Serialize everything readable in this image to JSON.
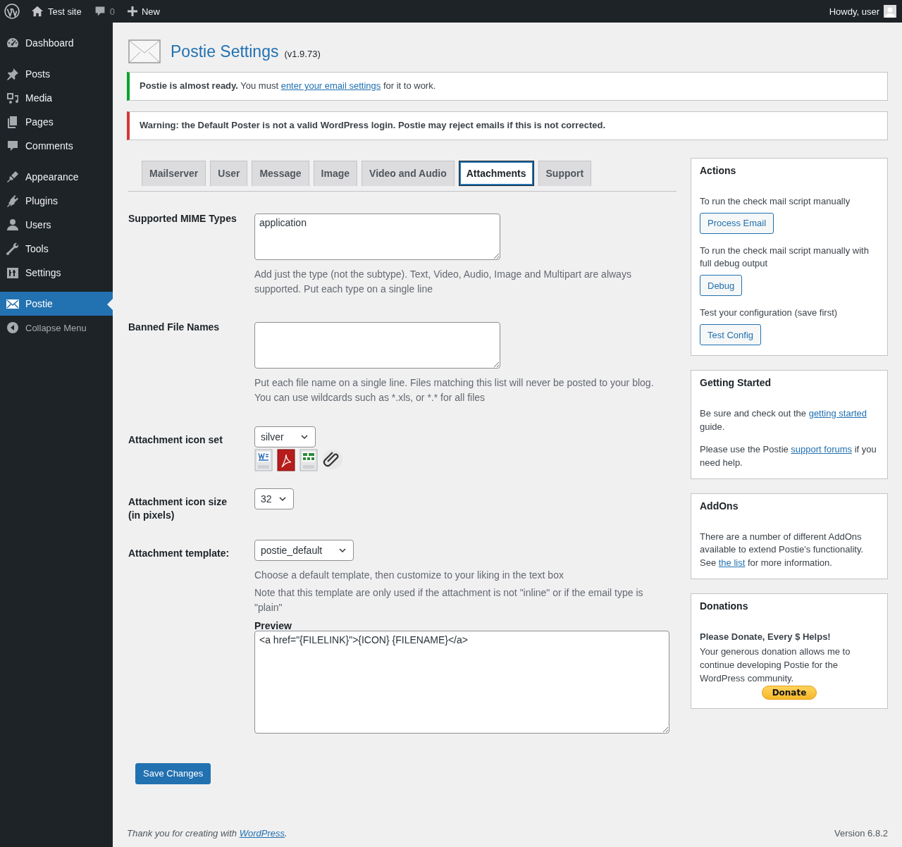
{
  "admin_bar": {
    "site": "Test site",
    "comments": "0",
    "new": "New",
    "greeting": "Howdy, user"
  },
  "sidebar": {
    "groups": [
      [
        {
          "label": "Dashboard",
          "selected": false
        }
      ],
      [
        {
          "label": "Posts",
          "selected": false
        },
        {
          "label": "Media",
          "selected": false
        },
        {
          "label": "Pages",
          "selected": false
        },
        {
          "label": "Comments",
          "selected": false
        }
      ],
      [
        {
          "label": "Appearance",
          "selected": false
        },
        {
          "label": "Plugins",
          "selected": false
        },
        {
          "label": "Users",
          "selected": false
        },
        {
          "label": "Tools",
          "selected": false
        },
        {
          "label": "Settings",
          "selected": false
        }
      ],
      [
        {
          "label": "Postie",
          "selected": true
        }
      ]
    ],
    "collapse": "Collapse Menu"
  },
  "page": {
    "title": "Postie Settings",
    "version": "(v1.9.73)"
  },
  "notices": [
    {
      "kind": "success",
      "before": "**Postie is almost ready.** You must ",
      "link": "enter your email settings",
      "after": " for it to work."
    },
    {
      "kind": "error",
      "text": "Warning: the Default Poster is not a valid WordPress login. Postie may reject emails if this is not corrected."
    }
  ],
  "tabs": [
    {
      "label": "Mailserver",
      "selected": false
    },
    {
      "label": "User",
      "selected": false
    },
    {
      "label": "Message",
      "selected": false
    },
    {
      "label": "Image",
      "selected": false
    },
    {
      "label": "Video and Audio",
      "selected": false
    },
    {
      "label": "Attachments",
      "selected": true
    },
    {
      "label": "Support",
      "selected": false
    }
  ],
  "fields": [
    {
      "kind": "textarea",
      "label": "Supported MIME Types",
      "value": "application",
      "help": [
        "Add just the type (not the subtype). Text, Video, Audio, Image and Multipart are always supported. Put each type on a single line"
      ]
    },
    {
      "kind": "textarea",
      "label": "Banned File Names",
      "help": [
        "Put each file name on a single line. Files matching this list will never be posted to your blog. You can use wildcards such as *.xls, or *.* for all files"
      ]
    },
    {
      "kind": "select",
      "label": "Attachment icon set",
      "value": "silver",
      "preview_icons": true
    },
    {
      "kind": "select",
      "label": "Attachment icon size (in pixels)",
      "value": "32"
    },
    {
      "kind": "template",
      "label": "Attachment template:",
      "value": "postie_default",
      "help": [
        "Choose a default template, then customize to your liking in the text box",
        "Note that this template are only used if the attachment is not \"inline\" or if the email type is \"plain\""
      ],
      "preview_label": "Preview",
      "preview": "<a href=\"{FILELINK}\">{ICON} {FILENAME}</a>"
    }
  ],
  "save_button": "Save Changes",
  "boxes": [
    {
      "title": "Actions",
      "items": [
        {
          "kind": "text",
          "text": "To run the check mail script manually"
        },
        {
          "kind": "button",
          "text": "Process Email"
        },
        {
          "kind": "text",
          "text": "To run the check mail script manually with full debug output"
        },
        {
          "kind": "button",
          "text": "Debug"
        },
        {
          "kind": "text",
          "text": "Test your configuration (save first)"
        },
        {
          "kind": "button",
          "text": "Test Config"
        }
      ]
    },
    {
      "title": "Getting Started",
      "items": [
        {
          "kind": "text",
          "before": "Be sure and check out the ",
          "link": "getting started",
          "after": " guide."
        },
        {
          "kind": "text",
          "before": "Please use the Postie ",
          "link": "support forums",
          "after": " if you need help."
        }
      ]
    },
    {
      "title": "AddOns",
      "items": [
        {
          "kind": "text",
          "before": "There are a number of different AddOns available to extend Postie's functionality. See ",
          "link": "the list",
          "after": " for more information."
        }
      ]
    },
    {
      "title": "Donations",
      "items": [
        {
          "kind": "strong",
          "text": "Please Donate, Every $ Helps!"
        },
        {
          "kind": "tight",
          "text": "Your generous donation allows me to continue developing Postie for the WordPress community."
        },
        {
          "kind": "donate",
          "text": "Donate"
        }
      ]
    }
  ],
  "footer": {
    "before": "Thank you for creating with ",
    "link": "WordPress",
    "after": ".",
    "version": "Version 6.8.2"
  }
}
